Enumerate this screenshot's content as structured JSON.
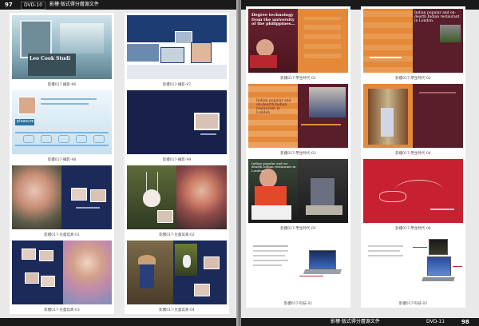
{
  "left_page": {
    "page_number": "97",
    "header_chip": "DVD-10",
    "header_title": "影樓·版式得分層源文件",
    "thumbnails": [
      {
        "caption": "影樓017-攝影-96",
        "image_text": "Leo Cook Studi"
      },
      {
        "caption": "影樓017-攝影-97",
        "image_text": ""
      },
      {
        "caption": "影樓017-攝影-98",
        "image_text": "pleasure"
      },
      {
        "caption": "影樓017-攝影-99",
        "image_text": ""
      },
      {
        "caption": "影樓017-兒童寫真-01",
        "image_text": ""
      },
      {
        "caption": "影樓017-兒童寫真-02",
        "image_text": ""
      },
      {
        "caption": "影樓017-兒童寫真-03",
        "image_text": ""
      },
      {
        "caption": "影樓017-兒童寫真-04",
        "image_text": ""
      }
    ]
  },
  "right_page": {
    "page_number": "98",
    "header_chip": "DVD-11",
    "header_title": "影樓·版式得分層源文件",
    "thumbnails": [
      {
        "caption": "影樓017-學生時代-01",
        "image_text": "Degree technology from the university of the philippines..."
      },
      {
        "caption": "影樓017-學生時代-02",
        "image_text": "Indian popular and on-dearth Indian restaurant in London."
      },
      {
        "caption": "影樓017-學生時代-03",
        "image_text": "Indian popular and on-dearth Indian restaurant in London."
      },
      {
        "caption": "影樓017-學生時代-04",
        "image_text": ""
      },
      {
        "caption": "影樓017-學生時代-05",
        "image_text": "Indian popular and on-dearth Indian restaurant in London."
      },
      {
        "caption": "影樓017-學生時代-06",
        "image_text": ""
      },
      {
        "caption": "影樓017-科技-01",
        "image_text": ""
      },
      {
        "caption": "影樓017-科技-02",
        "image_text": ""
      }
    ]
  },
  "colors": {
    "navy": "#1f3a6e",
    "dark_navy": "#17214a",
    "orange": "#e48a3a",
    "maroon": "#5a1e2a",
    "red": "#c72030"
  }
}
